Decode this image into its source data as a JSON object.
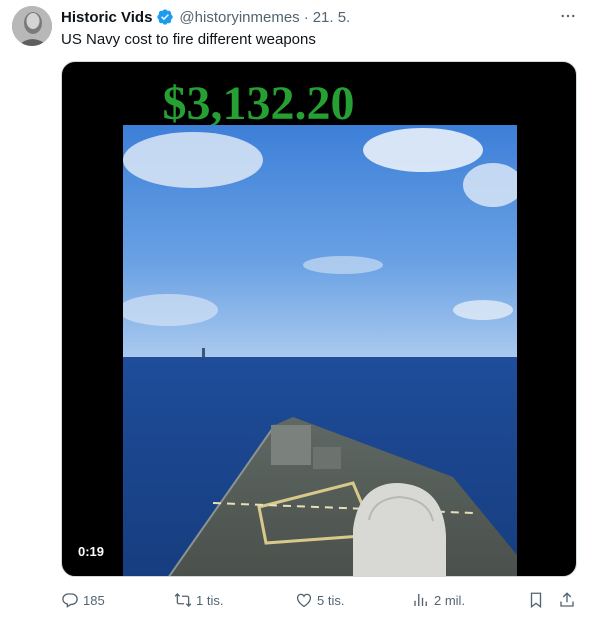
{
  "author": {
    "name": "Historic Vids",
    "handle": "@historyinmemes",
    "separator": "·",
    "date": "21. 5."
  },
  "tweet": {
    "text": "US Navy cost to fire different weapons"
  },
  "media": {
    "cost_overlay": "$3,132.20",
    "duration": "0:19"
  },
  "actions": {
    "replies": "185",
    "reposts": "1 tis.",
    "likes": "5 tis.",
    "views": "2 mil."
  },
  "colors": {
    "cost_green": "#27a033",
    "verified_blue": "#1d9bf0",
    "muted_text": "#536471"
  },
  "icons": [
    "verified-badge-icon",
    "more-icon",
    "reply-icon",
    "repost-icon",
    "like-icon",
    "views-icon",
    "bookmark-icon",
    "share-icon"
  ]
}
